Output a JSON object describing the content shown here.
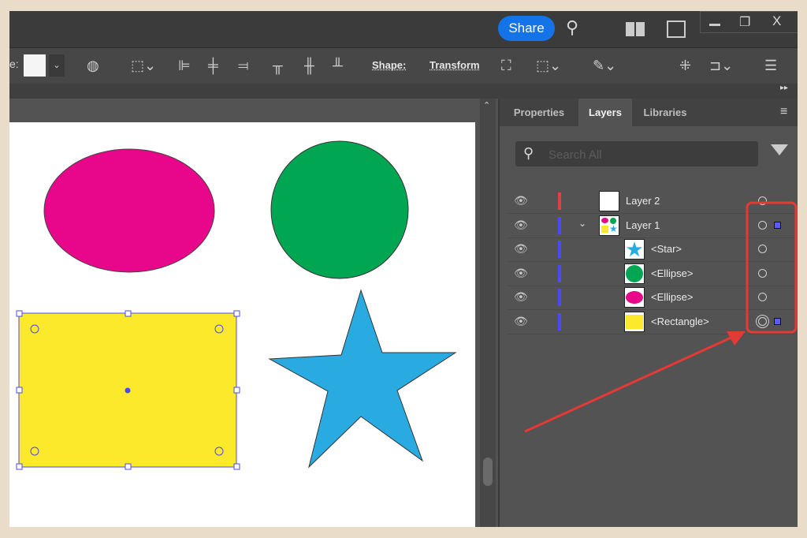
{
  "titlebar": {
    "share_label": "Share",
    "icons": [
      "search-icon",
      "arrange-documents-icon",
      "workspace-icon",
      "minimize-icon",
      "restore-icon",
      "close-icon"
    ],
    "close_label": "X"
  },
  "toolbar": {
    "shape_label": "Shape:",
    "transform_label": "Transform",
    "fill_color": "#f5f5f5"
  },
  "panel": {
    "tabs": [
      {
        "label": "Properties"
      },
      {
        "label": "Layers",
        "active": true
      },
      {
        "label": "Libraries"
      }
    ],
    "search_placeholder": "Search All",
    "layers": [
      {
        "name": "Layer 2",
        "color": "#e04040",
        "level": 0,
        "thumb": "blank",
        "selected": false
      },
      {
        "name": "Layer 1",
        "color": "#4a4aff",
        "level": 0,
        "expanded": true,
        "thumb": "mixed",
        "selected": true
      },
      {
        "name": "<Star>",
        "color": "#4a4aff",
        "level": 1,
        "thumb": "star",
        "selected": false
      },
      {
        "name": "<Ellipse>",
        "color": "#4a4aff",
        "level": 1,
        "thumb": "green-circle",
        "selected": false
      },
      {
        "name": "<Ellipse>",
        "color": "#4a4aff",
        "level": 1,
        "thumb": "pink-ellipse",
        "selected": false
      },
      {
        "name": "<Rectangle>",
        "color": "#4a4aff",
        "level": 1,
        "thumb": "yellow-rect",
        "selected": true,
        "targeted": true
      }
    ]
  },
  "artboard": {
    "shapes": [
      {
        "type": "ellipse",
        "fill": "#e8078a"
      },
      {
        "type": "circle",
        "fill": "#00a651"
      },
      {
        "type": "rectangle",
        "fill": "#fde92b",
        "selected": true
      },
      {
        "type": "star",
        "fill": "#29abe2"
      }
    ]
  },
  "annotation": {
    "highlight_color": "#e53935"
  }
}
